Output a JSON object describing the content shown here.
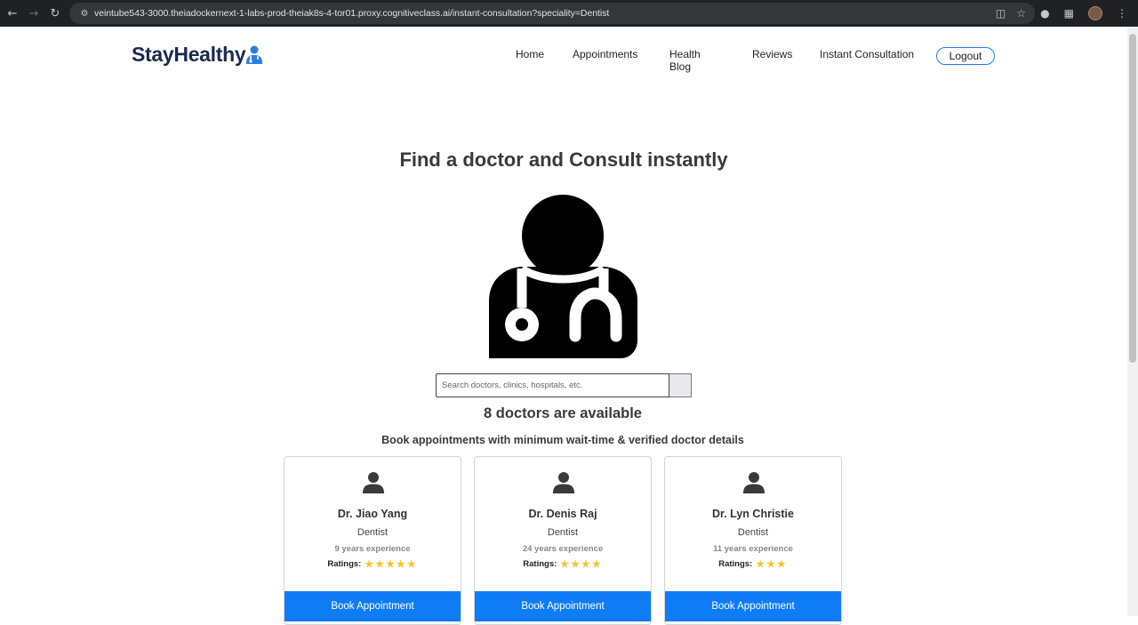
{
  "browser": {
    "url": "veintube543-3000.theiadockernext-1-labs-prod-theiak8s-4-tor01.proxy.cognitiveclass.ai/instant-consultation?speciality=Dentist"
  },
  "brand": {
    "name": "StayHealthy",
    "accent": "#2a7de1"
  },
  "nav": {
    "home": "Home",
    "appointments": "Appointments",
    "health_blog": "Health Blog",
    "reviews": "Reviews",
    "instant_consultation": "Instant Consultation",
    "logout": "Logout"
  },
  "hero": {
    "title": "Find a doctor and Consult instantly",
    "search_placeholder": "Search doctors, clinics, hospitals, etc."
  },
  "results": {
    "count_text": "8 doctors are available",
    "subtitle": "Book appointments with minimum wait-time & verified doctor details"
  },
  "doctors": [
    {
      "name": "Dr. Jiao Yang",
      "speciality": "Dentist",
      "experience": "9 years experience",
      "ratings_label": "Ratings:",
      "rating": 5,
      "stars": "★★★★★",
      "button": "Book Appointment"
    },
    {
      "name": "Dr. Denis Raj",
      "speciality": "Dentist",
      "experience": "24 years experience",
      "ratings_label": "Ratings:",
      "rating": 4,
      "stars": "★★★★",
      "button": "Book Appointment"
    },
    {
      "name": "Dr. Lyn Christie",
      "speciality": "Dentist",
      "experience": "11 years experience",
      "ratings_label": "Ratings:",
      "rating": 3,
      "stars": "★★★",
      "button": "Book Appointment"
    }
  ],
  "colors": {
    "button": "#0d7cf5",
    "star": "#f4c430",
    "heading": "#3a3a3a"
  }
}
